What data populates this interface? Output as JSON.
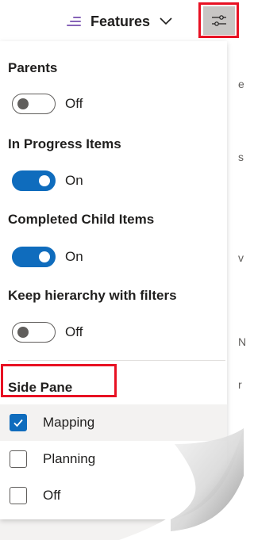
{
  "header": {
    "view_label": "Features",
    "view_icon": "list-icon",
    "chevron_icon": "chevron-down-icon",
    "filter_icon": "sliders-icon"
  },
  "background": {
    "glyphs": [
      "e",
      "s",
      "v",
      "N",
      "r"
    ]
  },
  "panel": {
    "parents": {
      "title": "Parents",
      "state": "Off",
      "on": false
    },
    "in_progress": {
      "title": "In Progress Items",
      "state": "On",
      "on": true
    },
    "completed_child": {
      "title": "Completed Child Items",
      "state": "On",
      "on": true
    },
    "keep_hierarchy": {
      "title": "Keep hierarchy with filters",
      "state": "Off",
      "on": false
    },
    "side_pane": {
      "title": "Side Pane",
      "options": [
        {
          "label": "Mapping",
          "checked": true
        },
        {
          "label": "Planning",
          "checked": false
        },
        {
          "label": "Off",
          "checked": false
        }
      ]
    }
  },
  "colors": {
    "accent": "#0f6cbd",
    "highlight": "#e81123",
    "list_icon": "#8764b8"
  }
}
